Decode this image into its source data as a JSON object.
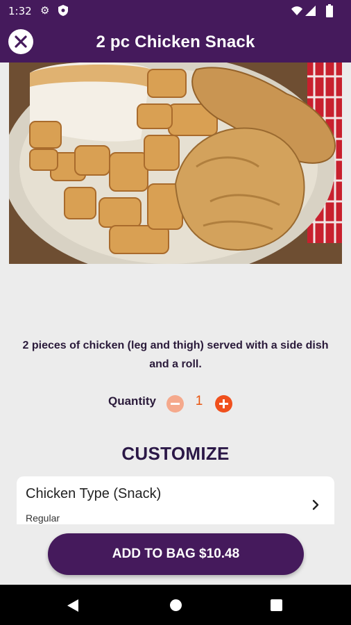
{
  "status_bar": {
    "time": "1:32",
    "icons": [
      "gear-icon",
      "shield-icon",
      "wifi-icon",
      "signal-icon",
      "battery-icon"
    ]
  },
  "header": {
    "title": "2 pc Chicken Snack",
    "close_icon": "close-icon",
    "background_color": "#451a5c"
  },
  "hero_image": {
    "subject": "plate of fried chicken with roasted potatoes and a roll"
  },
  "description": "2 pieces of chicken (leg and thigh) served with a side dish and a roll.",
  "quantity": {
    "label": "Quantity",
    "value": "1",
    "minus_icon": "minus-icon",
    "plus_icon": "plus-icon",
    "accent_color": "#f0501d"
  },
  "customize": {
    "heading": "CUSTOMIZE",
    "options": [
      {
        "title": "Chicken Type (Snack)",
        "selected": "Regular",
        "icon": "chevron-right-icon"
      }
    ]
  },
  "cta": {
    "label": "ADD TO BAG $10.48"
  },
  "nav_bar": {
    "icons": [
      "back-icon",
      "home-icon",
      "recents-icon"
    ]
  }
}
